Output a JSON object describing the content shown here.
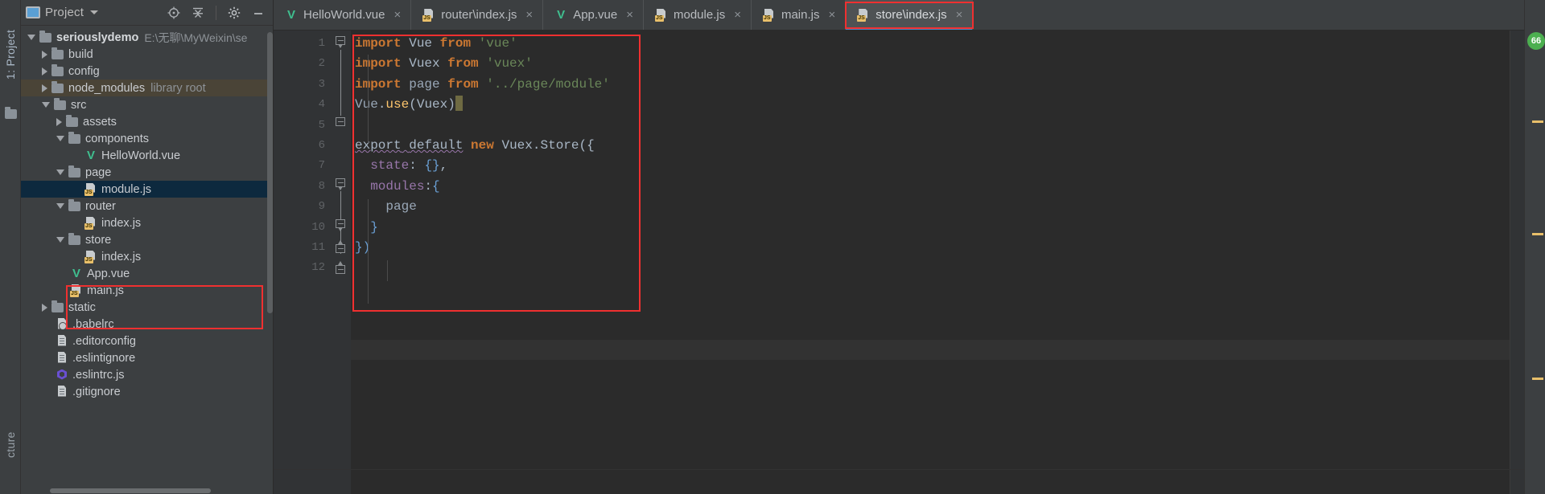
{
  "window": {
    "left_strip_label": "1: Project",
    "left_strip_bottom_label": "cture"
  },
  "project_panel": {
    "title": "Project",
    "icons": [
      "project-view-icon",
      "locate-icon",
      "collapse-all-icon",
      "settings-gear-icon",
      "minimize-icon"
    ],
    "tree": [
      {
        "depth": 0,
        "arrow": "open",
        "icon": "folder",
        "label": "seriouslydemo",
        "bold": true,
        "sub": "E:\\无聊\\MyWeixin\\se"
      },
      {
        "depth": 1,
        "arrow": "closed",
        "icon": "folder",
        "label": "build",
        "sub": ""
      },
      {
        "depth": 1,
        "arrow": "closed",
        "icon": "folder",
        "label": "config",
        "sub": ""
      },
      {
        "depth": 1,
        "arrow": "closed",
        "icon": "folder",
        "label": "node_modules",
        "sub": "library root",
        "state": "hover"
      },
      {
        "depth": 1,
        "arrow": "open",
        "icon": "folder",
        "label": "src",
        "sub": ""
      },
      {
        "depth": 2,
        "arrow": "closed",
        "icon": "folder",
        "label": "assets",
        "sub": ""
      },
      {
        "depth": 2,
        "arrow": "open",
        "icon": "folder",
        "label": "components",
        "sub": ""
      },
      {
        "depth": 3,
        "arrow": "none",
        "icon": "vue",
        "label": "HelloWorld.vue",
        "sub": ""
      },
      {
        "depth": 2,
        "arrow": "open",
        "icon": "folder",
        "label": "page",
        "sub": ""
      },
      {
        "depth": 3,
        "arrow": "none",
        "icon": "js",
        "label": "module.js",
        "sub": "",
        "state": "selected"
      },
      {
        "depth": 2,
        "arrow": "open",
        "icon": "folder",
        "label": "router",
        "sub": ""
      },
      {
        "depth": 3,
        "arrow": "none",
        "icon": "js",
        "label": "index.js",
        "sub": ""
      },
      {
        "depth": 2,
        "arrow": "open",
        "icon": "folder",
        "label": "store",
        "sub": ""
      },
      {
        "depth": 3,
        "arrow": "none",
        "icon": "js",
        "label": "index.js",
        "sub": ""
      },
      {
        "depth": 2,
        "arrow": "none",
        "icon": "vue",
        "label": "App.vue",
        "sub": ""
      },
      {
        "depth": 2,
        "arrow": "none",
        "icon": "js",
        "label": "main.js",
        "sub": ""
      },
      {
        "depth": 1,
        "arrow": "closed",
        "icon": "folder",
        "label": "static",
        "sub": ""
      },
      {
        "depth": 1,
        "arrow": "none",
        "icon": "babel",
        "label": ".babelrc",
        "sub": ""
      },
      {
        "depth": 1,
        "arrow": "none",
        "icon": "doc",
        "label": ".editorconfig",
        "sub": ""
      },
      {
        "depth": 1,
        "arrow": "none",
        "icon": "doc",
        "label": ".eslintignore",
        "sub": ""
      },
      {
        "depth": 1,
        "arrow": "none",
        "icon": "eslint",
        "label": ".eslintrc.js",
        "sub": ""
      },
      {
        "depth": 1,
        "arrow": "none",
        "icon": "doc",
        "label": ".gitignore",
        "sub": ""
      }
    ]
  },
  "tabs": [
    {
      "label": "HelloWorld.vue",
      "icon": "vue",
      "active": false,
      "close": "×"
    },
    {
      "label": "router\\index.js",
      "icon": "js",
      "active": false,
      "close": "×"
    },
    {
      "label": "App.vue",
      "icon": "vue",
      "active": false,
      "close": "×"
    },
    {
      "label": "module.js",
      "icon": "js",
      "active": false,
      "close": "×"
    },
    {
      "label": "main.js",
      "icon": "js",
      "active": false,
      "close": "×"
    },
    {
      "label": "store\\index.js",
      "icon": "js",
      "active": true,
      "close": "×"
    }
  ],
  "editor": {
    "line_numbers": [
      "1",
      "2",
      "3",
      "4",
      "5",
      "6",
      "7",
      "8",
      "9",
      "10",
      "11",
      "12"
    ],
    "lines": [
      {
        "n": 1,
        "text": "import Vue from 'vue'"
      },
      {
        "n": 2,
        "text": "import Vuex from 'vuex'"
      },
      {
        "n": 3,
        "text": "import page from '../page/module'"
      },
      {
        "n": 4,
        "text": "Vue.use(Vuex)"
      },
      {
        "n": 5,
        "text": ""
      },
      {
        "n": 6,
        "text": "export default new Vuex.Store({"
      },
      {
        "n": 7,
        "text": "  state: {},"
      },
      {
        "n": 8,
        "text": "  modules:{"
      },
      {
        "n": 9,
        "text": "    page"
      },
      {
        "n": 10,
        "text": "  }"
      },
      {
        "n": 11,
        "text": "})"
      },
      {
        "n": 12,
        "text": ""
      }
    ]
  },
  "right_panel": {
    "badge_label": "66",
    "badge_color": "#4caf50"
  },
  "colors": {
    "background": "#2b2b2b",
    "panel": "#3c3f41",
    "gutter": "#313335",
    "keyword": "#cc7832",
    "string": "#6a8759",
    "identifier": "#a9b7c6",
    "property": "#9876aa",
    "selection": "#0d293e",
    "accent": "#4a88c7",
    "highlight_box": "#f03030"
  }
}
